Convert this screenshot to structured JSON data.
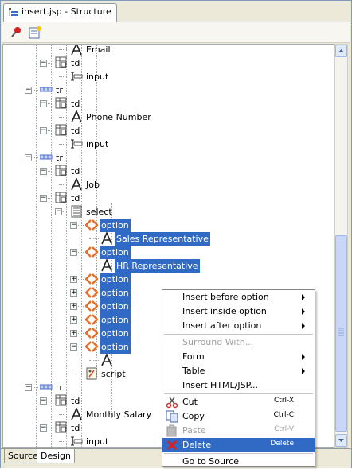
{
  "window": {
    "tab_title": "insert.jsp - Structure"
  },
  "toolbar": {
    "pin_icon": "pin-icon",
    "new_icon": "new-view-icon"
  },
  "tree": {
    "rows": [
      {
        "depth": 6,
        "type": "text",
        "label": "Email",
        "toggle": "none"
      },
      {
        "depth": 5,
        "type": "td",
        "label": "td",
        "toggle": "minus"
      },
      {
        "depth": 6,
        "type": "input",
        "label": "input",
        "toggle": "none"
      },
      {
        "depth": 4,
        "type": "tr",
        "label": "tr",
        "toggle": "minus"
      },
      {
        "depth": 5,
        "type": "td",
        "label": "td",
        "toggle": "minus"
      },
      {
        "depth": 6,
        "type": "text",
        "label": "Phone Number",
        "toggle": "none"
      },
      {
        "depth": 5,
        "type": "td",
        "label": "td",
        "toggle": "minus"
      },
      {
        "depth": 6,
        "type": "input",
        "label": "input",
        "toggle": "none"
      },
      {
        "depth": 4,
        "type": "tr",
        "label": "tr",
        "toggle": "minus"
      },
      {
        "depth": 5,
        "type": "td",
        "label": "td",
        "toggle": "minus"
      },
      {
        "depth": 6,
        "type": "text",
        "label": "Job",
        "toggle": "none"
      },
      {
        "depth": 5,
        "type": "td",
        "label": "td",
        "toggle": "minus"
      },
      {
        "depth": 6,
        "type": "select",
        "label": "select",
        "toggle": "minus"
      },
      {
        "depth": 7,
        "type": "option",
        "label": "option",
        "toggle": "minus",
        "selected": true
      },
      {
        "depth": 8,
        "type": "text",
        "label": "Sales Representative",
        "toggle": "none",
        "selected": true
      },
      {
        "depth": 7,
        "type": "option",
        "label": "option",
        "toggle": "minus",
        "selected": true
      },
      {
        "depth": 8,
        "type": "text",
        "label": "HR Representative",
        "toggle": "none",
        "selected": true
      },
      {
        "depth": 7,
        "type": "option",
        "label": "option",
        "toggle": "plus",
        "selected": true
      },
      {
        "depth": 7,
        "type": "option",
        "label": "option",
        "toggle": "plus",
        "selected": true
      },
      {
        "depth": 7,
        "type": "option",
        "label": "option",
        "toggle": "plus",
        "selected": true
      },
      {
        "depth": 7,
        "type": "option",
        "label": "option",
        "toggle": "plus",
        "selected": true
      },
      {
        "depth": 7,
        "type": "option",
        "label": "option",
        "toggle": "plus",
        "selected": true
      },
      {
        "depth": 7,
        "type": "option",
        "label": "option",
        "toggle": "minus",
        "selected": true
      },
      {
        "depth": 8,
        "type": "text",
        "label": "",
        "toggle": "none"
      },
      {
        "depth": 7,
        "type": "script",
        "label": "script",
        "toggle": "none"
      },
      {
        "depth": 4,
        "type": "tr",
        "label": "tr",
        "toggle": "minus"
      },
      {
        "depth": 5,
        "type": "td",
        "label": "td",
        "toggle": "minus"
      },
      {
        "depth": 6,
        "type": "text",
        "label": "Monthly Salary",
        "toggle": "none"
      },
      {
        "depth": 5,
        "type": "td",
        "label": "td",
        "toggle": "minus"
      },
      {
        "depth": 6,
        "type": "input",
        "label": "input",
        "toggle": "none"
      }
    ]
  },
  "context_menu": {
    "items": [
      {
        "label": "Insert before option",
        "sub": true,
        "enabled": true
      },
      {
        "label": "Insert inside option",
        "sub": true,
        "enabled": true
      },
      {
        "label": "Insert after option",
        "sub": true,
        "enabled": true
      },
      {
        "sep": true
      },
      {
        "label": "Surround With...",
        "sub": false,
        "enabled": false
      },
      {
        "label": "Form",
        "sub": true,
        "enabled": true
      },
      {
        "label": "Table",
        "sub": true,
        "enabled": true
      },
      {
        "label": "Insert HTML/JSP...",
        "sub": false,
        "enabled": true
      },
      {
        "sep": true
      },
      {
        "label": "Cut",
        "shortcut": "Ctrl-X",
        "icon": "scissors-icon",
        "enabled": true
      },
      {
        "label": "Copy",
        "shortcut": "Ctrl-C",
        "icon": "copy-icon",
        "enabled": true
      },
      {
        "label": "Paste",
        "shortcut": "Ctrl-V",
        "icon": "paste-icon",
        "enabled": false
      },
      {
        "label": "Delete",
        "shortcut": "Delete",
        "icon": "delete-icon",
        "enabled": true,
        "highlighted": true
      },
      {
        "sep": true
      },
      {
        "label": "Go to Source",
        "sub": false,
        "enabled": true
      }
    ]
  },
  "bottom_tabs": [
    {
      "label": "Source",
      "active": false
    },
    {
      "label": "Design",
      "active": true
    }
  ],
  "colors": {
    "selection": "#316ac5",
    "option_icon": "#e8702a",
    "tag_icon": "#5a6fa0",
    "tr_icon": "#4a6fcf"
  }
}
